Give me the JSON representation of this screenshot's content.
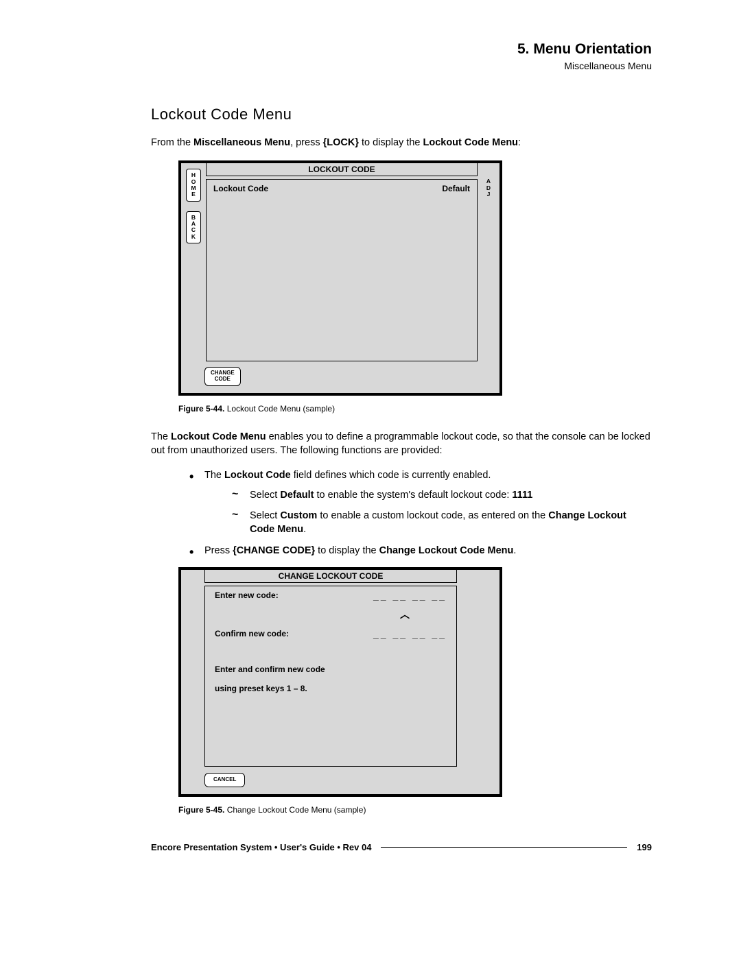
{
  "header": {
    "chapter": "5.  Menu Orientation",
    "breadcrumb": "Miscellaneous Menu"
  },
  "section_heading": "Lockout Code Menu",
  "intro": {
    "prefix": "From the ",
    "menu_bold": "Miscellaneous Menu",
    "mid": ", press ",
    "key": "{LOCK}",
    "mid2": " to display the ",
    "target_bold": "Lockout Code Menu",
    "suffix": ":"
  },
  "figure1": {
    "home": "H\nO\nM\nE",
    "back": "B\nA\nC\nK",
    "adj": "A\nD\nJ",
    "title": "LOCKOUT CODE",
    "row_label": "Lockout Code",
    "row_value": "Default",
    "change_code": "CHANGE\nCODE"
  },
  "caption1": {
    "num": "Figure 5-44.",
    "text": "  Lockout Code Menu  (sample)"
  },
  "para2": {
    "p1": "The ",
    "b1": "Lockout Code Menu",
    "p2": " enables you to define a programmable lockout code, so that the console can be locked out from unauthorized users.  The following functions are provided:"
  },
  "bullets": {
    "b1_p1": "The ",
    "b1_b1": "Lockout Code",
    "b1_p2": " field defines which code is currently enabled.",
    "sub1_p1": "Select ",
    "sub1_b1": "Default",
    "sub1_p2": " to enable the system's default lockout code:  ",
    "sub1_b2": "1111",
    "sub2_p1": "Select ",
    "sub2_b1": "Custom",
    "sub2_p2": " to enable a custom lockout code, as entered on the ",
    "sub2_b2": "Change Lockout Code Menu",
    "sub2_p3": ".",
    "b2_p1": "Press ",
    "b2_b1": "{CHANGE CODE}",
    "b2_p2": " to display the ",
    "b2_b2": "Change Lockout Code Menu",
    "b2_p3": "."
  },
  "figure2": {
    "title": "CHANGE LOCKOUT CODE",
    "enter_label": "Enter new code:",
    "confirm_label": "Confirm new code:",
    "underscores": "__ __ __ __",
    "caret": "︿",
    "instr1": "Enter and confirm new code",
    "instr2": "using preset keys 1 – 8.",
    "cancel": "CANCEL"
  },
  "caption2": {
    "num": "Figure 5-45.",
    "text": "  Change Lockout Code Menu  (sample)"
  },
  "footer": {
    "title": "Encore Presentation System  •  User's Guide  •  Rev 04",
    "page": "199"
  }
}
